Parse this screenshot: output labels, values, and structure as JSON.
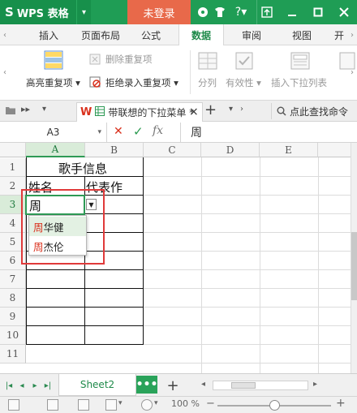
{
  "titlebar": {
    "app_name": "WPS 表格",
    "app_logo_glyph": "S",
    "menu_arrow": "▾",
    "login_label": "未登录",
    "icons": [
      "palette-icon",
      "shirt-icon",
      "help-icon",
      "upload-icon",
      "minimize-icon",
      "maximize-icon",
      "close-icon"
    ]
  },
  "ribbon_tabs": [
    "插入",
    "页面布局",
    "公式",
    "数据",
    "审阅",
    "视图",
    "开"
  ],
  "ribbon_active_tab": "数据",
  "ribbon": {
    "highlight_dup": "高亮重复项",
    "delete_dup": "删除重复项",
    "reject_dup": "拒绝录入重复项",
    "split": "分列",
    "validity": "有效性",
    "insert_dropdown": "插入下拉列表"
  },
  "docbar": {
    "doc_title": "带联想的下拉菜单 *",
    "close": "×",
    "add": "+",
    "search_label": "点此查找命令"
  },
  "formula_bar": {
    "name_box": "A3",
    "cancel": "✕",
    "confirm": "✓",
    "fx": "fx",
    "value": "周"
  },
  "grid": {
    "columns": [
      "A",
      "B",
      "C",
      "D",
      "E"
    ],
    "rows": [
      "1",
      "2",
      "3",
      "4",
      "5",
      "6",
      "7",
      "8",
      "9",
      "10",
      "11"
    ],
    "cells": {
      "title": "歌手信息",
      "name_header": "姓名",
      "works_header": "代表作",
      "a3_value": "周"
    }
  },
  "dropdown": {
    "items": [
      {
        "prefix": "周",
        "rest": "华健"
      },
      {
        "prefix": "周",
        "rest": "杰伦"
      }
    ]
  },
  "sheetbar": {
    "sheet_name": "Sheet2",
    "more": "•••",
    "add": "+"
  },
  "statusbar": {
    "zoom": "100 %",
    "zoom_level": 0.5
  },
  "colors": {
    "brand": "#1f9d55",
    "login": "#e8694a",
    "annotation": "#e03a3a"
  }
}
